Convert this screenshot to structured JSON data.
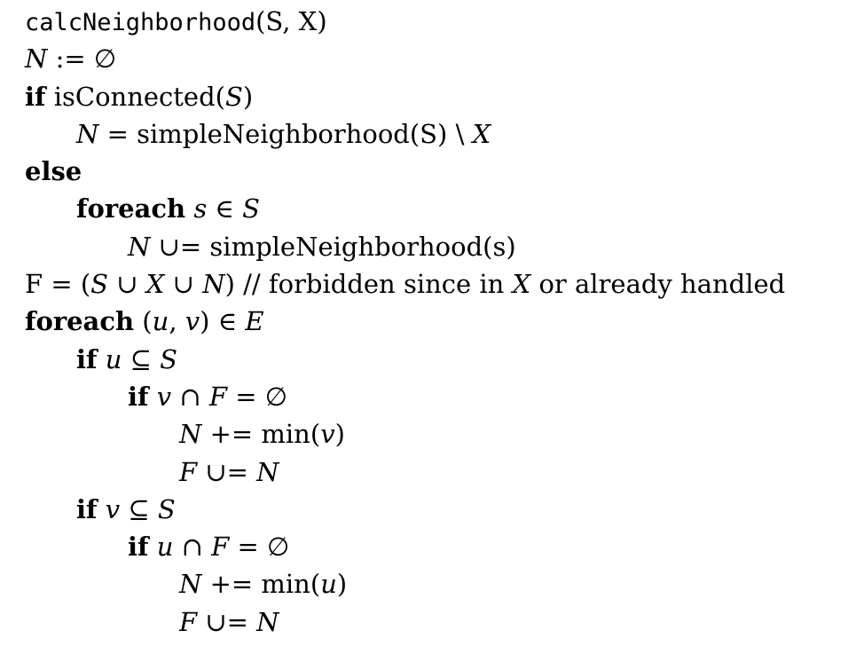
{
  "algorithm": {
    "header": {
      "name": "calcNeighborhood",
      "params": "(S, X)"
    },
    "lines": [
      {
        "id": "init",
        "indent": 0,
        "parts": [
          {
            "t": "N",
            "c": "mi"
          },
          {
            "t": " := ∅"
          }
        ]
      },
      {
        "id": "if-connected",
        "indent": 0,
        "parts": [
          {
            "t": "if",
            "c": "kw"
          },
          {
            "t": " isConnected("
          },
          {
            "t": "S",
            "c": "mi"
          },
          {
            "t": ")"
          }
        ]
      },
      {
        "id": "simple-neighborhood",
        "indent": 1,
        "parts": [
          {
            "t": "N",
            "c": "mi"
          },
          {
            "t": " = simpleNeighborhood(S) \\ "
          },
          {
            "t": "X",
            "c": "mi"
          }
        ]
      },
      {
        "id": "else",
        "indent": 0,
        "parts": [
          {
            "t": "else",
            "c": "kw"
          }
        ]
      },
      {
        "id": "foreach-s",
        "indent": 1,
        "parts": [
          {
            "t": "foreach",
            "c": "kw"
          },
          {
            "t": " "
          },
          {
            "t": "s",
            "c": "mi"
          },
          {
            "t": " ∈ "
          },
          {
            "t": "S",
            "c": "mi"
          }
        ]
      },
      {
        "id": "union-neighborhood",
        "indent": 2,
        "parts": [
          {
            "t": "N",
            "c": "mi"
          },
          {
            "t": " ∪= simpleNeighborhood(s)"
          }
        ]
      },
      {
        "id": "forbidden",
        "indent": 0,
        "parts": [
          {
            "t": "F = ("
          },
          {
            "t": "S",
            "c": "mi"
          },
          {
            "t": " ∪ "
          },
          {
            "t": "X",
            "c": "mi"
          },
          {
            "t": " ∪ "
          },
          {
            "t": "N",
            "c": "mi"
          },
          {
            "t": ") // forbidden since in "
          },
          {
            "t": "X",
            "c": "mi"
          },
          {
            "t": " or already handled"
          }
        ]
      },
      {
        "id": "foreach-edge",
        "indent": 0,
        "parts": [
          {
            "t": "foreach",
            "c": "kw"
          },
          {
            "t": " ("
          },
          {
            "t": "u",
            "c": "mi"
          },
          {
            "t": ", "
          },
          {
            "t": "v",
            "c": "mi"
          },
          {
            "t": ") ∈ "
          },
          {
            "t": "E",
            "c": "mi"
          }
        ]
      },
      {
        "id": "if-u-subset",
        "indent": 1,
        "parts": [
          {
            "t": "if",
            "c": "kw"
          },
          {
            "t": " "
          },
          {
            "t": "u",
            "c": "mi"
          },
          {
            "t": " ⊆ "
          },
          {
            "t": "S",
            "c": "mi"
          }
        ]
      },
      {
        "id": "if-v-disjoint",
        "indent": 2,
        "parts": [
          {
            "t": "if",
            "c": "kw"
          },
          {
            "t": " "
          },
          {
            "t": "v",
            "c": "mi"
          },
          {
            "t": " ∩ "
          },
          {
            "t": "F",
            "c": "mi"
          },
          {
            "t": " = ∅"
          }
        ]
      },
      {
        "id": "add-min-v",
        "indent": 3,
        "parts": [
          {
            "t": "N",
            "c": "mi"
          },
          {
            "t": " += min("
          },
          {
            "t": "v",
            "c": "mi"
          },
          {
            "t": ")"
          }
        ]
      },
      {
        "id": "update-f-1",
        "indent": 3,
        "parts": [
          {
            "t": "F",
            "c": "mi"
          },
          {
            "t": " ∪= "
          },
          {
            "t": "N",
            "c": "mi"
          }
        ]
      },
      {
        "id": "if-v-subset",
        "indent": 1,
        "parts": [
          {
            "t": "if",
            "c": "kw"
          },
          {
            "t": " "
          },
          {
            "t": "v",
            "c": "mi"
          },
          {
            "t": " ⊆ "
          },
          {
            "t": "S",
            "c": "mi"
          }
        ]
      },
      {
        "id": "if-u-disjoint",
        "indent": 2,
        "parts": [
          {
            "t": "if",
            "c": "kw"
          },
          {
            "t": " "
          },
          {
            "t": "u",
            "c": "mi"
          },
          {
            "t": " ∩ "
          },
          {
            "t": "F",
            "c": "mi"
          },
          {
            "t": " = ∅"
          }
        ]
      },
      {
        "id": "add-min-u",
        "indent": 3,
        "parts": [
          {
            "t": "N",
            "c": "mi"
          },
          {
            "t": " += min("
          },
          {
            "t": "u",
            "c": "mi"
          },
          {
            "t": ")"
          }
        ]
      },
      {
        "id": "update-f-2",
        "indent": 3,
        "parts": [
          {
            "t": "F",
            "c": "mi"
          },
          {
            "t": " ∪= "
          },
          {
            "t": "N",
            "c": "mi"
          }
        ]
      }
    ]
  }
}
